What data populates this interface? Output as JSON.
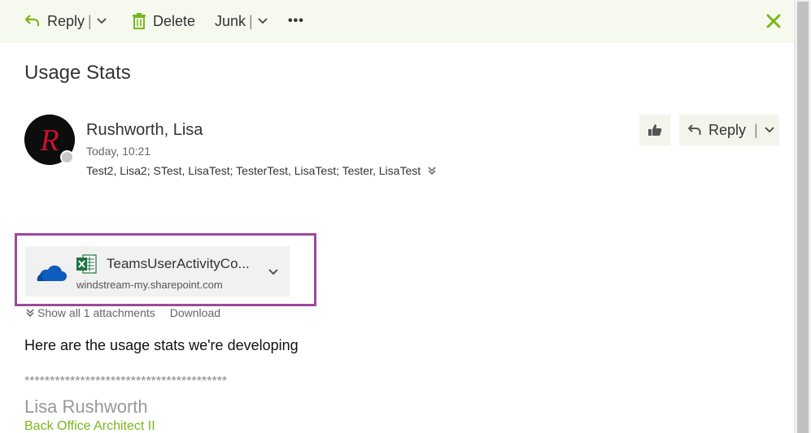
{
  "toolbar": {
    "reply_label": "Reply",
    "delete_label": "Delete",
    "junk_label": "Junk",
    "more_label": "•••",
    "separator": "|"
  },
  "message": {
    "subject": "Usage Stats",
    "sender_name": "Rushworth, Lisa",
    "avatar_letter": "R",
    "time": "Today, 10:21",
    "recipients": "Test2, Lisa2; STest, LisaTest; TesterTest, LisaTest; Tester, LisaTest",
    "reply_label": "Reply",
    "separator": "|"
  },
  "attachment": {
    "name": "TeamsUserActivityCo...",
    "source": "windstream-my.sharepoint.com",
    "show_all": "Show all 1 attachments",
    "download": "Download"
  },
  "body": {
    "text": "Here are the usage stats we're developing",
    "stars": "****************************************",
    "signature_name": "Lisa Rushworth",
    "signature_title": "Back Office Architect II"
  },
  "colors": {
    "accent_green": "#7ab51d",
    "highlight_purple": "#9b4a9c",
    "onedrive_blue": "#0f5cbf",
    "excel_green": "#1f7244"
  },
  "icons": [
    "reply-icon",
    "chevron-down-icon",
    "trash-icon",
    "more-icon",
    "close-icon",
    "like-icon",
    "onedrive-icon",
    "excel-icon",
    "expand-icon"
  ]
}
